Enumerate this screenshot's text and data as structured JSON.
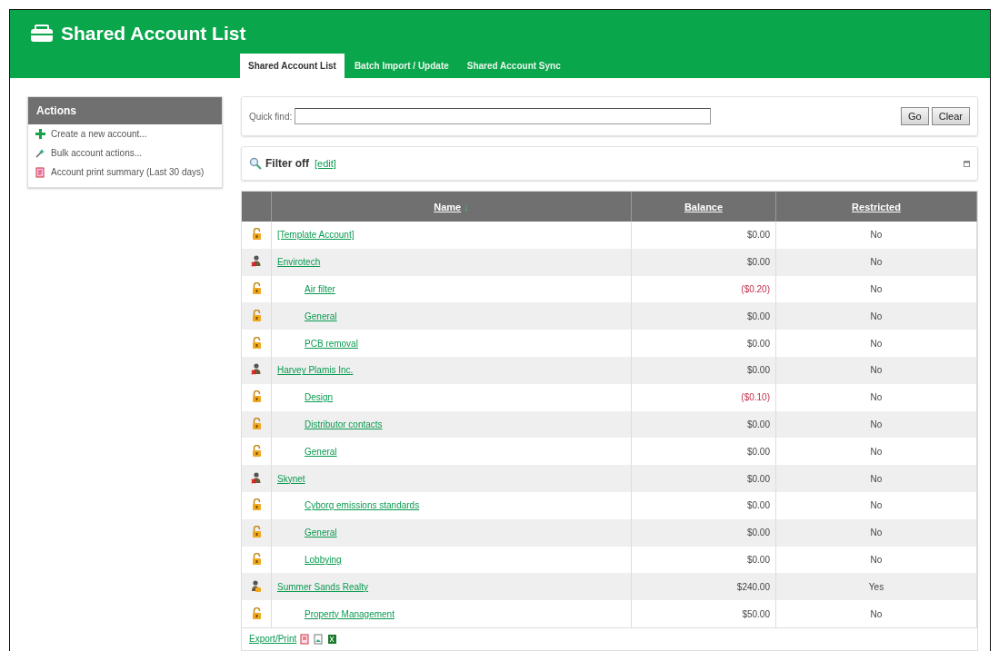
{
  "header": {
    "title": "Shared Account List"
  },
  "tabs": [
    {
      "label": "Shared Account List",
      "selected": true
    },
    {
      "label": "Batch Import / Update",
      "selected": false
    },
    {
      "label": "Shared Account Sync",
      "selected": false
    }
  ],
  "sidebar": {
    "title": "Actions",
    "items": [
      {
        "kind": "create",
        "label": "Create a new account..."
      },
      {
        "kind": "bulk",
        "label": "Bulk account actions..."
      },
      {
        "kind": "report",
        "label": "Account print summary (Last 30 days)"
      }
    ]
  },
  "quick_find": {
    "label": "Quick find:",
    "buttons": [
      "Go",
      "Clear"
    ]
  },
  "filter": {
    "label": "Filter off",
    "link": "[edit]"
  },
  "table": {
    "columns": [
      {
        "label": "Name",
        "sort": "↓"
      },
      {
        "label": "Balance"
      },
      {
        "label": "Restricted"
      }
    ],
    "rows": [
      {
        "kind": "padlock",
        "name": "[Template Account]",
        "balance": "$0.00",
        "negative": false,
        "restricted": "No"
      },
      {
        "kind": "person-disabled",
        "name": "Envirotech",
        "balance": "$0.00",
        "negative": false,
        "restricted": "No",
        "children": [
          {
            "kind": "padlock",
            "name": "Air filter",
            "balance": "($0.20)",
            "negative": true,
            "restricted": "No"
          },
          {
            "kind": "padlock",
            "name": "General",
            "balance": "$0.00",
            "negative": false,
            "restricted": "No"
          },
          {
            "kind": "padlock",
            "name": "PCB removal",
            "balance": "$0.00",
            "negative": false,
            "restricted": "No"
          }
        ]
      },
      {
        "kind": "person-disabled",
        "name": "Harvey Plamis Inc.",
        "balance": "$0.00",
        "negative": false,
        "restricted": "No",
        "children": [
          {
            "kind": "padlock",
            "name": "Design",
            "balance": "($0.10)",
            "negative": true,
            "restricted": "No"
          },
          {
            "kind": "padlock",
            "name": "Distributor contacts",
            "balance": "$0.00",
            "negative": false,
            "restricted": "No"
          },
          {
            "kind": "padlock",
            "name": "General",
            "balance": "$0.00",
            "negative": false,
            "restricted": "No"
          }
        ]
      },
      {
        "kind": "person-disabled",
        "name": "Skynet",
        "balance": "$0.00",
        "negative": false,
        "restricted": "No",
        "children": [
          {
            "kind": "padlock",
            "name": "Cyborg emissions standards",
            "balance": "$0.00",
            "negative": false,
            "restricted": "No"
          },
          {
            "kind": "padlock",
            "name": "General",
            "balance": "$0.00",
            "negative": false,
            "restricted": "No"
          },
          {
            "kind": "padlock",
            "name": "Lobbying",
            "balance": "$0.00",
            "negative": false,
            "restricted": "No"
          }
        ]
      },
      {
        "kind": "person-locked",
        "name": "Summer Sands Realty",
        "balance": "$240.00",
        "negative": false,
        "restricted": "Yes",
        "children": [
          {
            "kind": "padlock",
            "name": "Property Management",
            "balance": "$50.00",
            "negative": false,
            "restricted": "No"
          }
        ]
      }
    ]
  },
  "export": {
    "label": "Export/Print"
  }
}
